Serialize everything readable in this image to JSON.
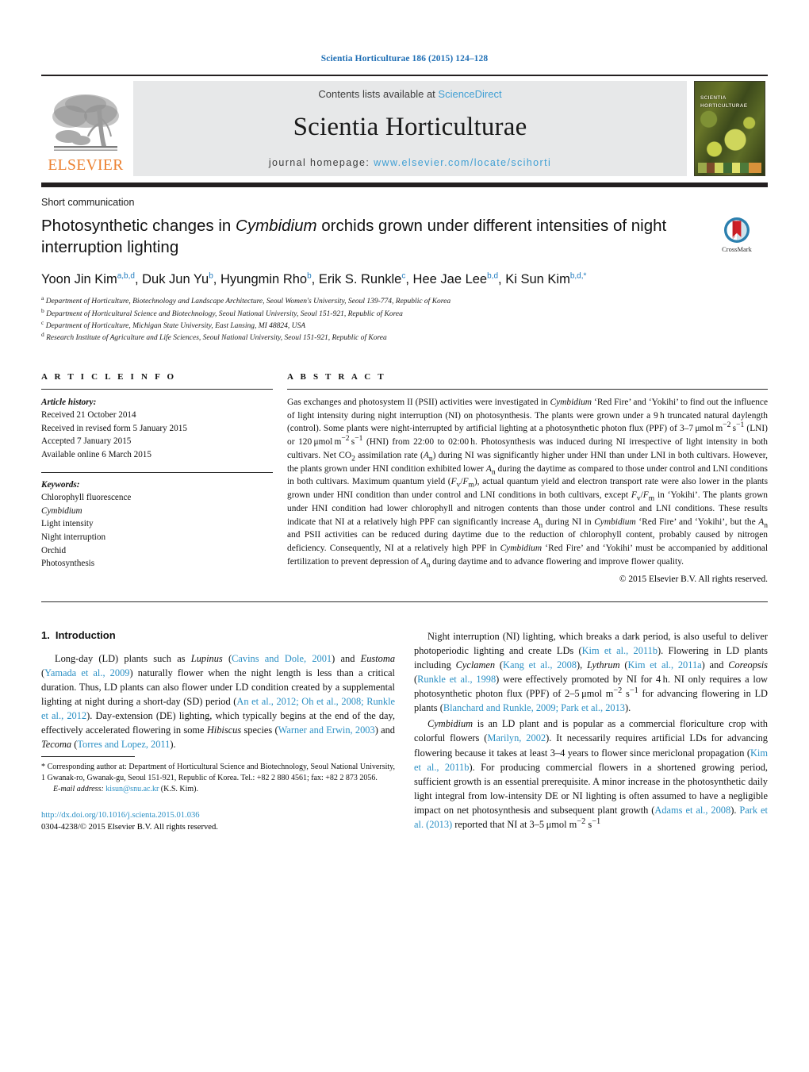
{
  "running_head": "Scientia Horticulturae 186 (2015) 124–128",
  "masthead": {
    "contents_prefix": "Contents lists available at ",
    "sciencedirect": "ScienceDirect",
    "journal_title": "Scientia Horticulturae",
    "homepage_prefix": "journal homepage: ",
    "homepage_url": "www.elsevier.com/locate/scihorti",
    "publisher_wordmark": "ELSEVIER",
    "cover_title_line1": "SCIENTIA",
    "cover_title_line2": "HORTICULTURAE",
    "accent_link_color": "#3f9fd4",
    "elsevier_orange": "#ec8131"
  },
  "article": {
    "kind": "Short communication",
    "title_html": "Photosynthetic changes in <i>Cymbidium</i> orchids grown under different intensities of night interruption lighting",
    "crossmark_label": "CrossMark",
    "authors_html": "Yoon Jin Kim<sup>a,b,d</sup>, Duk Jun Yu<sup>b</sup>, Hyungmin Rho<sup>b</sup>, Erik S. Runkle<sup>c</sup>, Hee Jae Lee<sup>b,d</sup>, Ki Sun Kim<sup>b,d,</sup><sup class=\"star\">*</sup>",
    "affiliations": [
      {
        "mark": "a",
        "text": "Department of Horticulture, Biotechnology and Landscape Architecture, Seoul Women's University, Seoul 139-774, Republic of Korea"
      },
      {
        "mark": "b",
        "text": "Department of Horticultural Science and Biotechnology, Seoul National University, Seoul 151-921, Republic of Korea"
      },
      {
        "mark": "c",
        "text": "Department of Horticulture, Michigan State University, East Lansing, MI 48824, USA"
      },
      {
        "mark": "d",
        "text": "Research Institute of Agriculture and Life Sciences, Seoul National University, Seoul 151-921, Republic of Korea"
      }
    ]
  },
  "article_info": {
    "heading": "A R T I C L E    I N F O",
    "history_label": "Article history:",
    "history": [
      "Received 21 October 2014",
      "Received in revised form 5 January 2015",
      "Accepted 7 January 2015",
      "Available online 6 March 2015"
    ],
    "keywords_label": "Keywords:",
    "keywords_html": [
      "Chlorophyll fluorescence",
      "<i>Cymbidium</i>",
      "Light intensity",
      "Night interruption",
      "Orchid",
      "Photosynthesis"
    ]
  },
  "abstract": {
    "heading": "A B S T R A C T",
    "body_html": "Gas exchanges and photosystem II (PSII) activities were investigated in <i>Cymbidium</i> &lsquo;Red Fire&rsquo; and &lsquo;Yokihi&rsquo; to find out the influence of light intensity during night interruption (NI) on photosynthesis. The plants were grown under a 9&thinsp;h truncated natural daylength (control). Some plants were night-interrupted by artificial lighting at a photosynthetic photon flux (PPF) of 3&ndash;7&thinsp;&mu;mol&thinsp;m<sup>&minus;2</sup>&thinsp;s<sup>&minus;1</sup> (LNI) or 120&thinsp;&mu;mol&thinsp;m<sup>&minus;2</sup>&thinsp;s<sup>&minus;1</sup> (HNI) from 22:00 to 02:00&thinsp;h. Photosynthesis was induced during NI irrespective of light intensity in both cultivars. Net CO<sub>2</sub> assimilation rate (<i>A</i><sub>n</sub>) during NI was significantly higher under HNI than under LNI in both cultivars. However, the plants grown under HNI condition exhibited lower <i>A</i><sub>n</sub> during the daytime as compared to those under control and LNI conditions in both cultivars. Maximum quantum yield (<i>F</i><sub>v</sub>/<i>F</i><sub>m</sub>), actual quantum yield and electron transport rate were also lower in the plants grown under HNI condition than under control and LNI conditions in both cultivars, except <i>F</i><sub>v</sub>/<i>F</i><sub>m</sub> in &lsquo;Yokihi&rsquo;. The plants grown under HNI condition had lower chlorophyll and nitrogen contents than those under control and LNI conditions. These results indicate that NI at a relatively high PPF can significantly increase <i>A</i><sub>n</sub> during NI in <i>Cymbidium</i> &lsquo;Red Fire&rsquo; and &lsquo;Yokihi&rsquo;, but the <i>A</i><sub>n</sub> and PSII activities can be reduced during daytime due to the reduction of chlorophyll content, probably caused by nitrogen deficiency. Consequently, NI at a relatively high PPF in <i>Cymbidium</i> &lsquo;Red Fire&rsquo; and &lsquo;Yokihi&rsquo; must be accompanied by additional fertilization to prevent depression of <i>A</i><sub>n</sub> during daytime and to advance flowering and improve flower quality.",
    "copyright": "© 2015 Elsevier B.V. All rights reserved."
  },
  "body": {
    "section_number": "1.",
    "section_title": "Introduction",
    "left_paragraphs_html": [
      "Long-day (LD) plants such as <i>Lupinus</i> (<span class=\"ref\">Cavins and Dole, 2001</span>) and <i>Eustoma</i> (<span class=\"ref\">Yamada et al., 2009</span>) naturally flower when the night length is less than a critical duration. Thus, LD plants can also flower under LD condition created by a supplemental lighting at night during a short-day (SD) period (<span class=\"ref\">An et al., 2012; Oh et al., 2008; Runkle et al., 2012</span>). Day-extension (DE) lighting, which typically begins at the end of the day, effectively accelerated flowering in some <i>Hibiscus</i> species (<span class=\"ref\">Warner and Erwin, 2003</span>) and <i>Tecoma</i> (<span class=\"ref\">Torres and Lopez, 2011</span>)."
    ],
    "right_paragraphs_html": [
      "Night interruption (NI) lighting, which breaks a dark period, is also useful to deliver photoperiodic lighting and create LDs (<span class=\"ref\">Kim et al., 2011b</span>). Flowering in LD plants including <i>Cyclamen</i> (<span class=\"ref\">Kang et al., 2008</span>), <i>Lythrum</i> (<span class=\"ref\">Kim et al., 2011a</span>) and <i>Coreopsis</i> (<span class=\"ref\">Runkle et al., 1998</span>) were effectively promoted by NI for 4&thinsp;h. NI only requires a low photosynthetic photon flux (PPF) of 2&ndash;5&thinsp;&mu;mol m<sup>&minus;2</sup> s<sup>&minus;1</sup> for advancing flowering in LD plants (<span class=\"ref\">Blanchard and Runkle, 2009; Park et al., 2013</span>).",
      "<i>Cymbidium</i> is an LD plant and is popular as a commercial floriculture crop with colorful flowers (<span class=\"ref\">Marilyn, 2002</span>). It necessarily requires artificial LDs for advancing flowering because it takes at least 3&ndash;4 years to flower since mericlonal propagation (<span class=\"ref\">Kim et al., 2011b</span>). For producing commercial flowers in a shortened growing period, sufficient growth is an essential prerequisite. A minor increase in the photosynthetic daily light integral from low-intensity DE or NI lighting is often assumed to have a negligible impact on net photosynthesis and subsequent plant growth (<span class=\"ref\">Adams et al., 2008</span>). <span class=\"ref\">Park et al. (2013)</span> reported that NI at 3&ndash;5&thinsp;&mu;mol m<sup>&minus;2</sup> s<sup>&minus;1</sup>"
    ]
  },
  "footnotes": {
    "corresponding_html": "<span class=\"star\">*</span> Corresponding author at: Department of Horticultural Science and Biotechnology, Seoul National University, 1 Gwanak-ro, Gwanak-gu, Seoul 151-921, Republic of Korea. Tel.: +82 2 880 4561; fax: +82 2 873 2056.",
    "email_label": "E-mail address:",
    "email": "kisun@snu.ac.kr",
    "email_owner": "(K.S. Kim).",
    "doi": "http://dx.doi.org/10.1016/j.scienta.2015.01.036",
    "issn_line": "0304-4238/© 2015 Elsevier B.V. All rights reserved."
  }
}
